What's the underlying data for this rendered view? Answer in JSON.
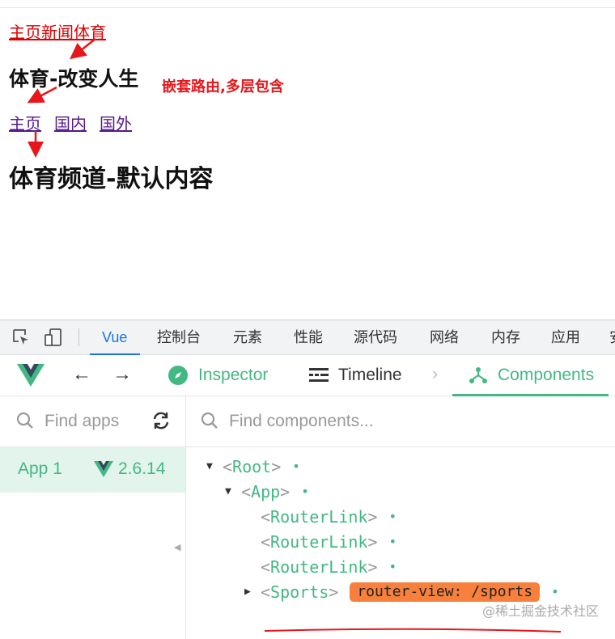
{
  "page": {
    "nav_links": [
      "主页",
      "新闻",
      "体育"
    ],
    "sports_title": "体育-改变人生",
    "annotation": "嵌套路由,多层包含",
    "sub_links": [
      "主页",
      "国内",
      "国外"
    ],
    "default_title": "体育频道-默认内容",
    "annotation_color": "#e8161b"
  },
  "devtools": {
    "tabs": [
      "Vue",
      "控制台",
      "元素",
      "性能",
      "源代码",
      "网络",
      "内存",
      "应用",
      "安"
    ],
    "active_tab": "Vue",
    "vue_tabs": {
      "inspector": "Inspector",
      "timeline": "Timeline",
      "components": "Components"
    },
    "apps_search_placeholder": "Find apps",
    "components_search_placeholder": "Find components...",
    "app": {
      "name": "App 1",
      "version": "2.6.14"
    },
    "tree": {
      "root": "Root",
      "app": "App",
      "links": [
        "RouterLink",
        "RouterLink",
        "RouterLink"
      ],
      "sports": "Sports",
      "badge": "router-view: /sports"
    },
    "watermark": "@稀土掘金技术社区",
    "accent_color": "#42b883",
    "badge_color": "#f7813c"
  }
}
